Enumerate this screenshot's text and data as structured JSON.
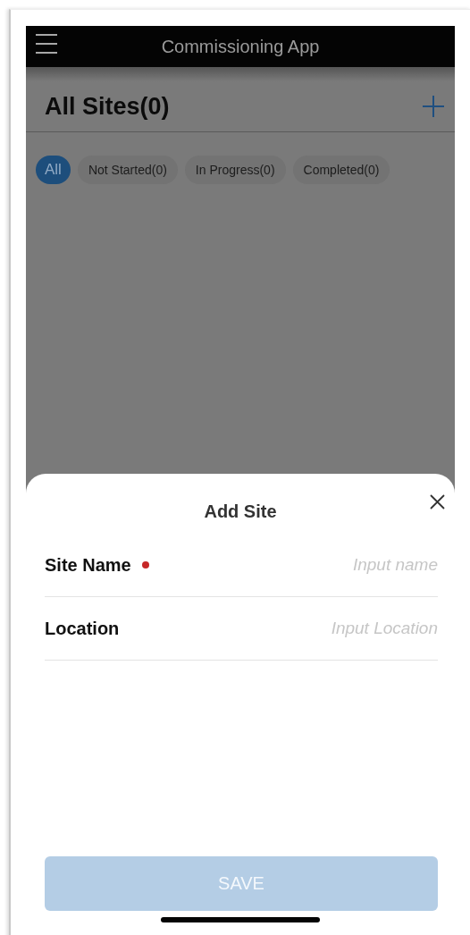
{
  "app_bar": {
    "title": "Commissioning App"
  },
  "page": {
    "title": "All Sites(0)"
  },
  "filters": [
    {
      "label": "All",
      "selected": true
    },
    {
      "label": "Not Started(0)",
      "selected": false
    },
    {
      "label": "In Progress(0)",
      "selected": false
    },
    {
      "label": "Completed(0)",
      "selected": false
    }
  ],
  "sheet": {
    "title": "Add Site",
    "fields": [
      {
        "label": "Site Name",
        "required": true,
        "placeholder": "Input name"
      },
      {
        "label": "Location",
        "required": false,
        "placeholder": "Input Location"
      }
    ],
    "save_button": {
      "label": "SAVE",
      "disabled": true
    }
  }
}
